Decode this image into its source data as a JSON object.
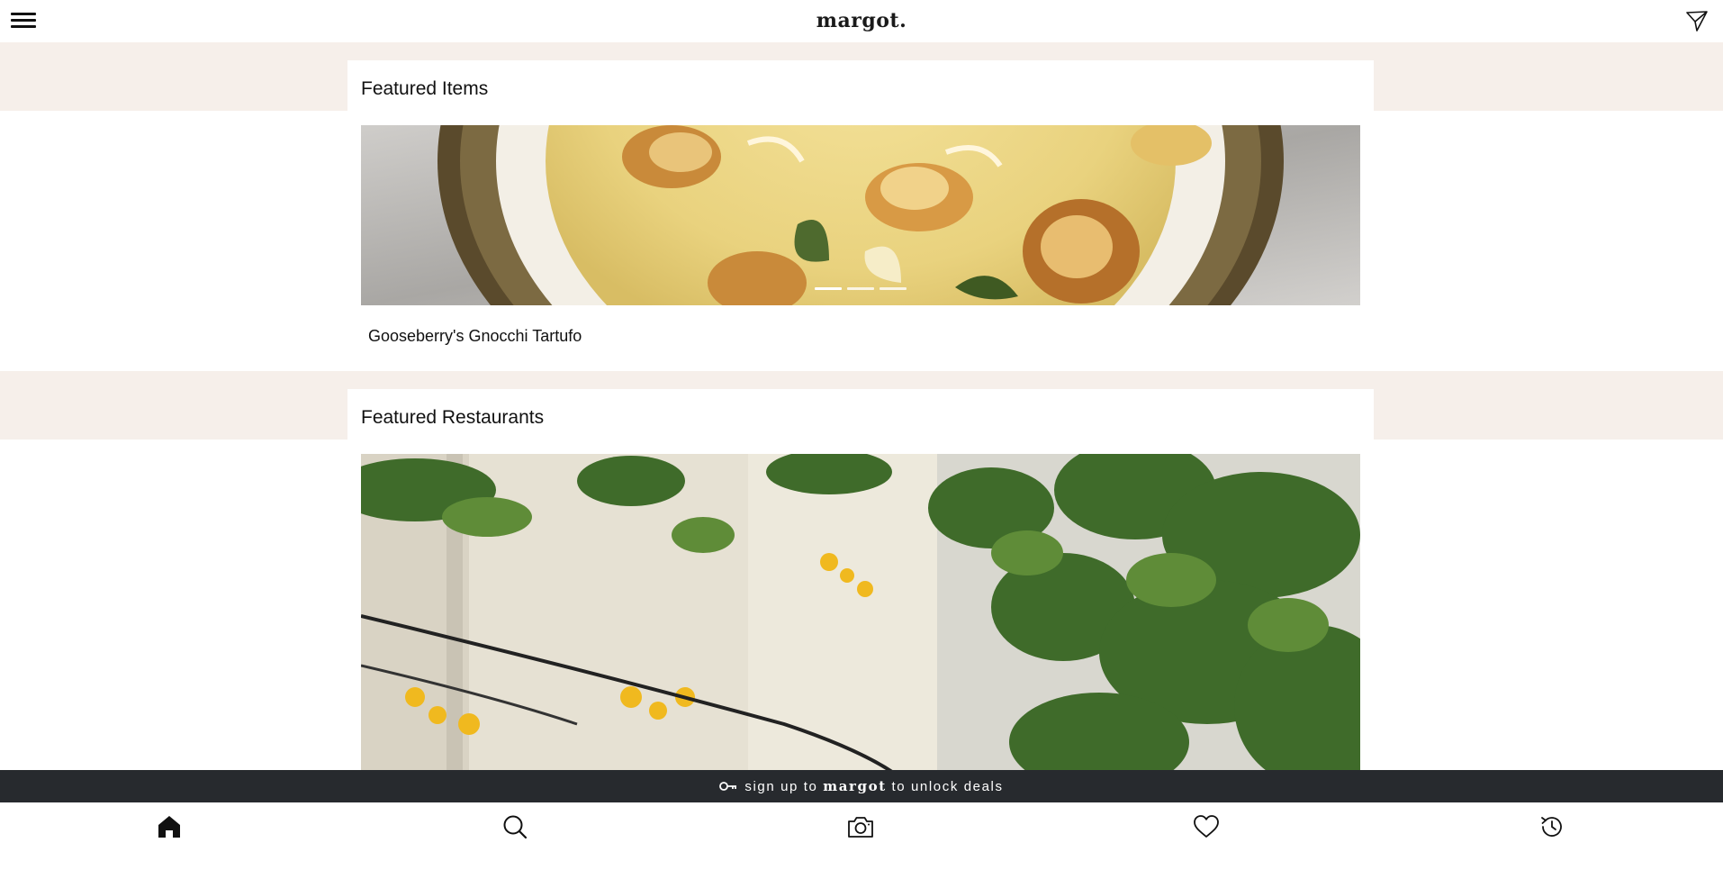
{
  "header": {
    "logo": "margot.",
    "menu_icon": "hamburger-menu-icon",
    "send_icon": "send-icon"
  },
  "featured_items": {
    "title": "Featured Items",
    "carousel_slides": 3,
    "carousel_active": 0,
    "item_name": "Gooseberry's Gnocchi Tartufo"
  },
  "featured_restaurants": {
    "title": "Featured Restaurants"
  },
  "promo": {
    "key_icon": "key-icon",
    "prefix": "sign up to",
    "brand": "margot",
    "suffix": "to unlock deals"
  },
  "bottom_nav": {
    "items": [
      {
        "icon": "home-icon",
        "active": true
      },
      {
        "icon": "search-icon",
        "active": false
      },
      {
        "icon": "camera-icon",
        "active": false
      },
      {
        "icon": "heart-icon",
        "active": false
      },
      {
        "icon": "history-icon",
        "active": false
      }
    ]
  },
  "colors": {
    "band": "#f6efea",
    "promo_bg": "#272a2e",
    "text": "#111111"
  }
}
